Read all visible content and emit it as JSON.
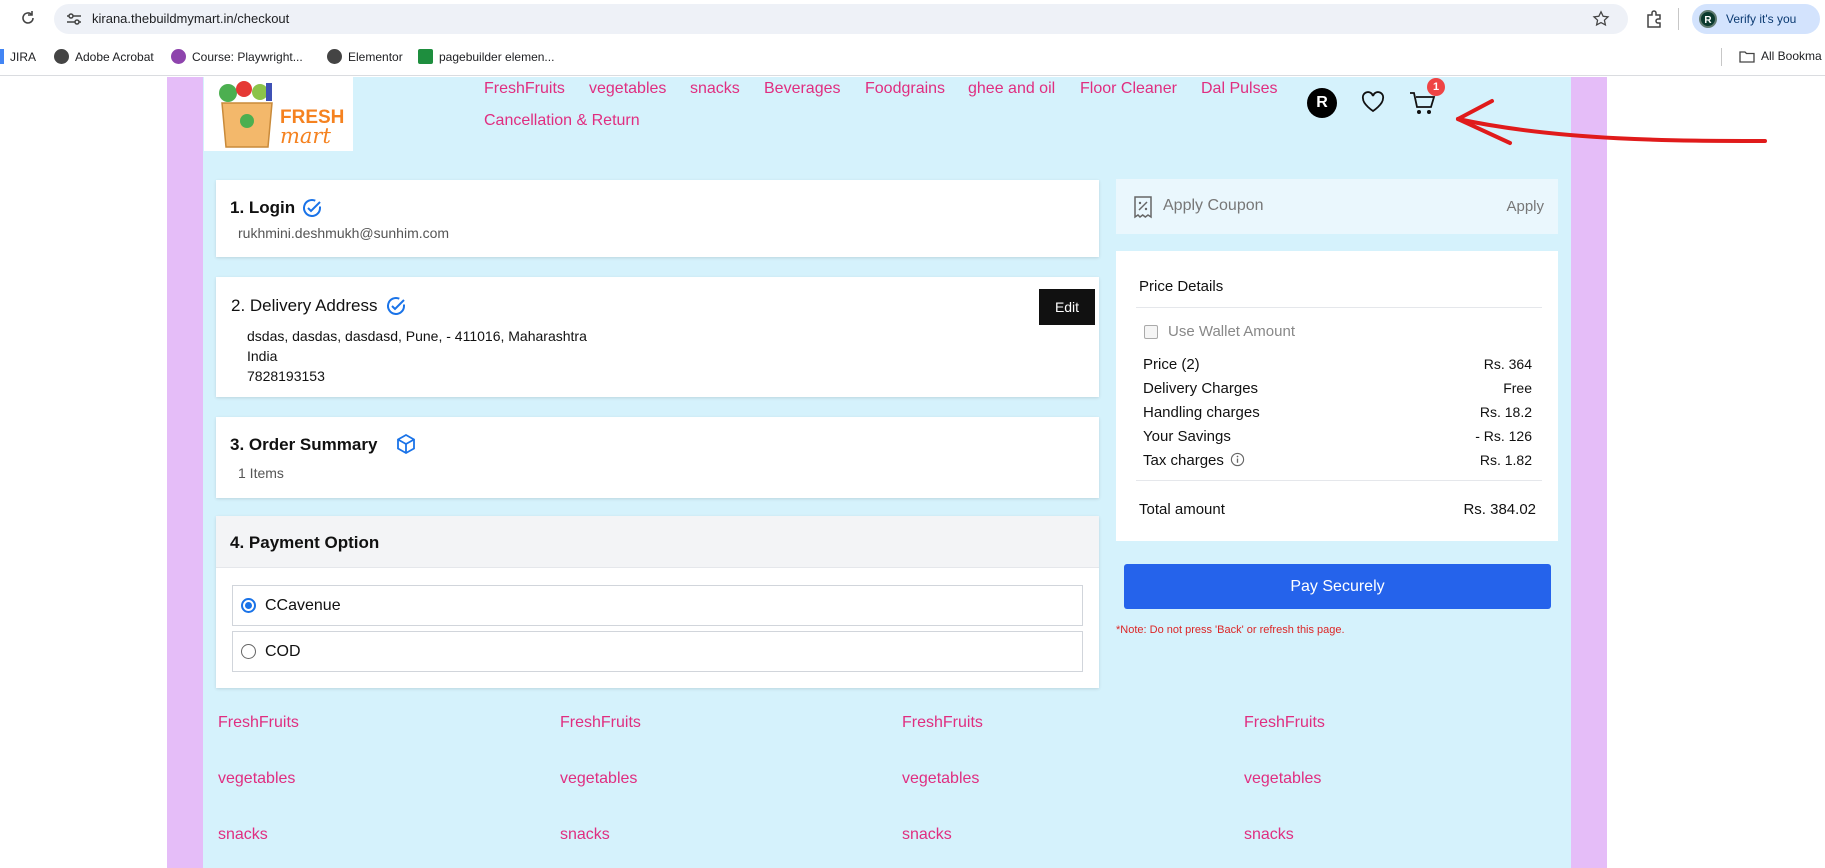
{
  "browser": {
    "url": "kirana.thebuildmymart.in/checkout",
    "verify_label": "Verify it's you",
    "profile_initial": "R",
    "bookmarks": [
      "JIRA",
      "Adobe Acrobat",
      "Course: Playwright...",
      "Elementor",
      "pagebuilder elemen..."
    ],
    "all_bookmarks": "All Bookma"
  },
  "header": {
    "logo_line1": "FRESH",
    "logo_line2": "mart",
    "nav": [
      "FreshFruits",
      "vegetables",
      "snacks",
      "Beverages",
      "Foodgrains",
      "ghee and oil",
      "Floor Cleaner",
      "Dal Pulses",
      "Cancellation & Return"
    ],
    "avatar_initial": "R",
    "cart_count": "1"
  },
  "checkout": {
    "login": {
      "title": "1. Login",
      "email": "rukhmini.deshmukh@sunhim.com"
    },
    "delivery": {
      "title": "2. Delivery Address",
      "edit_label": "Edit",
      "address_line": "dsdas, dasdas, dasdasd, Pune, - 411016, Maharashtra",
      "country": "India",
      "phone": "7828193153"
    },
    "order_summary": {
      "title": "3. Order Summary",
      "items": "1 Items"
    },
    "payment": {
      "title": "4. Payment Option",
      "options": [
        "CCavenue",
        "COD"
      ],
      "selected": "CCavenue"
    }
  },
  "coupon": {
    "label": "Apply Coupon",
    "apply": "Apply"
  },
  "price_details": {
    "title": "Price Details",
    "wallet_label": "Use Wallet Amount",
    "rows": [
      {
        "label": "Price (2)",
        "value": "Rs. 364"
      },
      {
        "label": "Delivery Charges",
        "value": "Free"
      },
      {
        "label": "Handling charges",
        "value": "Rs. 18.2"
      },
      {
        "label": "Your Savings",
        "value": "- Rs. 126"
      },
      {
        "label": "Tax charges",
        "value": "Rs. 1.82"
      }
    ],
    "total_label": "Total amount",
    "total_value": "Rs. 384.02"
  },
  "pay": {
    "button": "Pay Securely",
    "note": "*Note: Do not press 'Back' or refresh this page."
  },
  "footer": {
    "columns": [
      [
        "FreshFruits",
        "vegetables",
        "snacks"
      ],
      [
        "FreshFruits",
        "vegetables",
        "snacks"
      ],
      [
        "FreshFruits",
        "vegetables",
        "snacks"
      ],
      [
        "FreshFruits",
        "vegetables",
        "snacks"
      ]
    ]
  },
  "colors": {
    "accent_pink": "#e02e80",
    "page_bg": "#d5f2fc",
    "side_bg": "#e5bdf8",
    "pay_button": "#2563eb",
    "note_red": "#dc2626"
  },
  "icons": {
    "reload": "reload-icon",
    "star": "star-icon",
    "extensions": "puzzle-icon",
    "heart": "heart-icon",
    "cart": "cart-icon",
    "check": "check-circle-icon",
    "box": "box-icon",
    "coupon": "coupon-icon",
    "info": "info-icon",
    "arrow": "red-arrow-annotation"
  }
}
